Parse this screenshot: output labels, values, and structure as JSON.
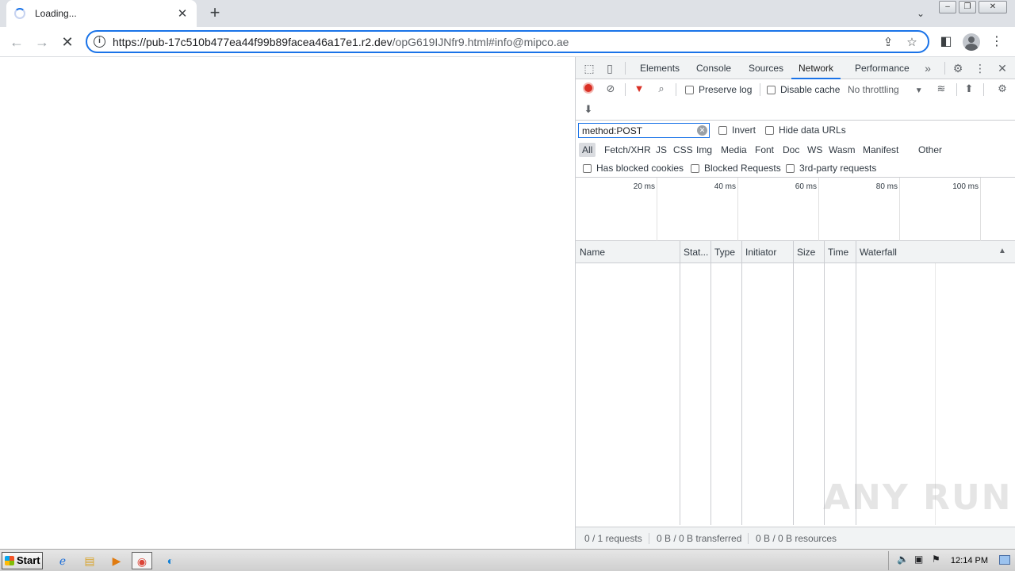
{
  "browser": {
    "tab_title": "Loading...",
    "url_host": "https://pub-17c510b477ea44f99b89facea46a17e1.r2.dev",
    "url_path": "/opG619IJNfr9.html#info@mipco.ae"
  },
  "devtools": {
    "tabs": [
      "Elements",
      "Console",
      "Sources",
      "Network",
      "Performance"
    ],
    "active_tab": "Network",
    "toolbar": {
      "preserve_log": "Preserve log",
      "disable_cache": "Disable cache",
      "throttling": "No throttling"
    },
    "filter": {
      "value": "method:POST",
      "invert": "Invert",
      "hide_data_urls": "Hide data URLs"
    },
    "types": [
      "All",
      "Fetch/XHR",
      "JS",
      "CSS",
      "Img",
      "Media",
      "Font",
      "Doc",
      "WS",
      "Wasm",
      "Manifest",
      "Other"
    ],
    "cookies": {
      "has_blocked": "Has blocked cookies",
      "blocked_requests": "Blocked Requests",
      "third_party": "3rd-party requests"
    },
    "overview_ticks": [
      "20 ms",
      "40 ms",
      "60 ms",
      "80 ms",
      "100 ms"
    ],
    "columns": [
      "Name",
      "Stat...",
      "Type",
      "Initiator",
      "Size",
      "Time",
      "Waterfall"
    ],
    "status": {
      "requests": "0 / 1 requests",
      "transferred": "0 B / 0 B transferred",
      "resources": "0 B / 0 B resources"
    },
    "watermark": "ANY RUN"
  },
  "taskbar": {
    "start_label": "Start",
    "clock": "12:14 PM"
  },
  "colors": {
    "accent": "#1a73e8",
    "record": "#d93025",
    "filter_icon": "#d93025"
  }
}
